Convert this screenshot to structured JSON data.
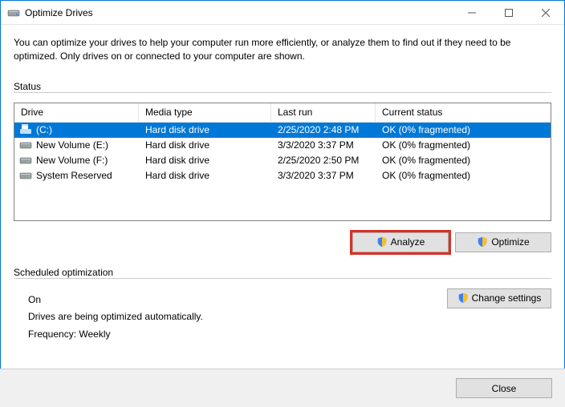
{
  "window": {
    "title": "Optimize Drives",
    "description": "You can optimize your drives to help your computer run more efficiently, or analyze them to find out if they need to be optimized. Only drives on or connected to your computer are shown."
  },
  "status": {
    "legend": "Status",
    "columns": {
      "drive": "Drive",
      "media": "Media type",
      "last": "Last run",
      "status": "Current status"
    },
    "rows": [
      {
        "name": "(C:)",
        "media": "Hard disk drive",
        "last": "2/25/2020 2:48 PM",
        "status": "OK (0% fragmented)",
        "selected": true,
        "kind": "os"
      },
      {
        "name": "New Volume (E:)",
        "media": "Hard disk drive",
        "last": "3/3/2020 3:37 PM",
        "status": "OK (0% fragmented)",
        "selected": false,
        "kind": "hdd"
      },
      {
        "name": "New Volume (F:)",
        "media": "Hard disk drive",
        "last": "2/25/2020 2:50 PM",
        "status": "OK (0% fragmented)",
        "selected": false,
        "kind": "hdd"
      },
      {
        "name": "System Reserved",
        "media": "Hard disk drive",
        "last": "3/3/2020 3:37 PM",
        "status": "OK (0% fragmented)",
        "selected": false,
        "kind": "hdd"
      }
    ]
  },
  "buttons": {
    "analyze": "Analyze",
    "optimize": "Optimize",
    "change_settings": "Change settings",
    "close": "Close"
  },
  "schedule": {
    "legend": "Scheduled optimization",
    "state": "On",
    "desc": "Drives are being optimized automatically.",
    "freq": "Frequency: Weekly"
  }
}
